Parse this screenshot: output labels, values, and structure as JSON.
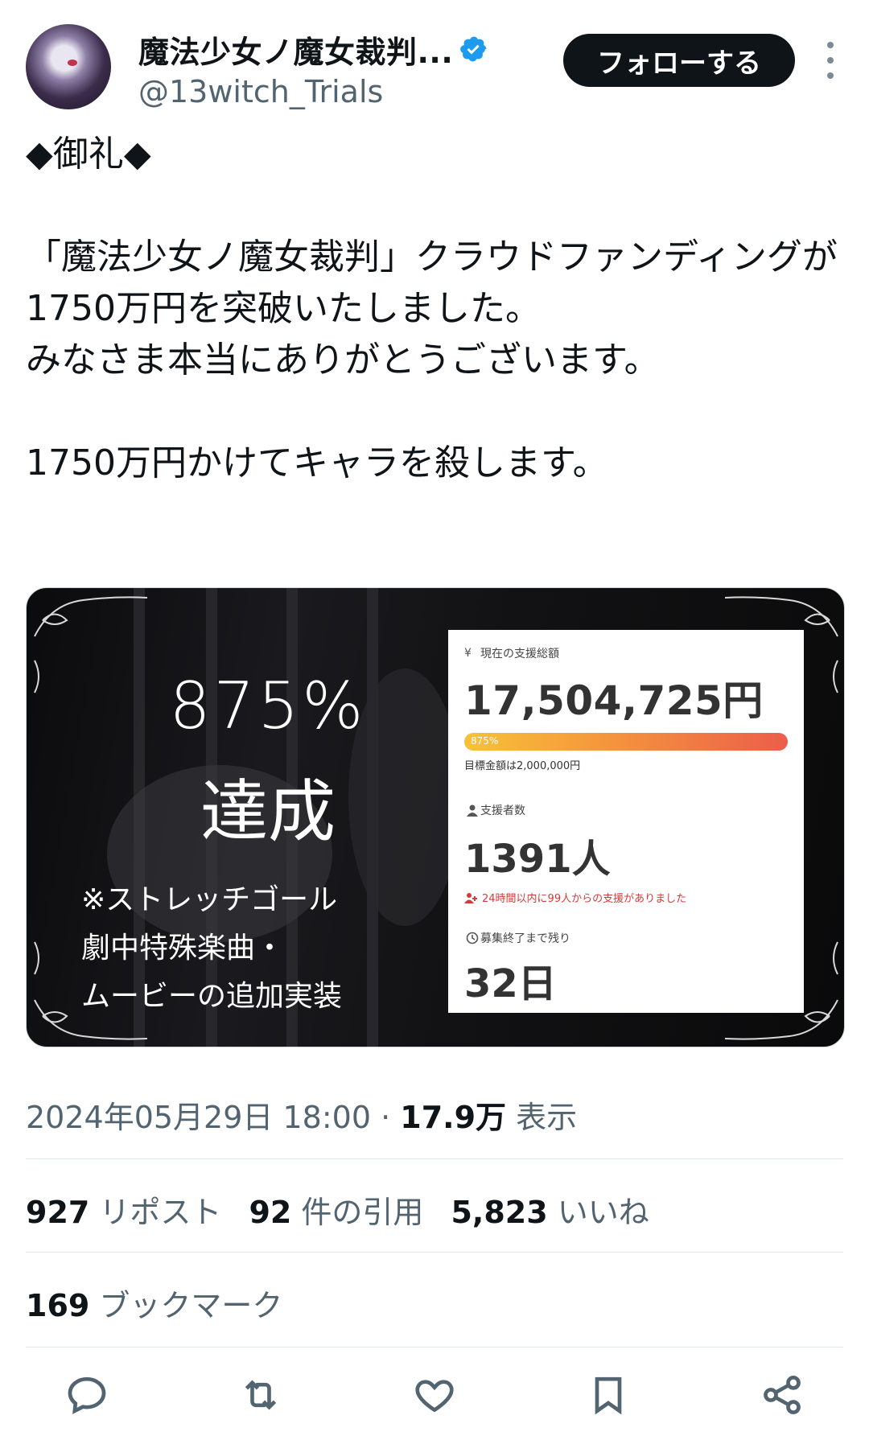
{
  "author": {
    "display_name": "魔法少女ノ魔女裁判...",
    "handle": "@13witch_Trials",
    "follow_label": "フォローする"
  },
  "tweet": {
    "text": "◆御礼◆\n\n「魔法少女ノ魔女裁判」クラウドファンディングが\n1750万円を突破いたしました。\nみなさま本当にありがとうございます。\n\n1750万円かけてキャラを殺します。"
  },
  "media": {
    "achievement_percent": "875%",
    "achievement_word": "達成",
    "stretch_goal": "※ストレッチゴール\n劇中特殊楽曲・\nムービーの追加実装",
    "panel": {
      "total_label": "現在の支援総額",
      "total_amount": "17,504,725円",
      "progress_label": "875%",
      "progress_percent": 875,
      "goal_text": "目標金額は2,000,000円",
      "backers_label": "支援者数",
      "backers_count": "1391人",
      "recent_text": "24時間以内に99人からの支援がありました",
      "remaining_label": "募集終了まで残り",
      "remaining_days": "32日"
    }
  },
  "meta": {
    "timestamp": "2024年05月29日 18:00",
    "separator": "·",
    "views_count": "17.9万",
    "views_label": "表示"
  },
  "stats": {
    "reposts_count": "927",
    "reposts_label": "リポスト",
    "quotes_count": "92",
    "quotes_label": "件の引用",
    "likes_count": "5,823",
    "likes_label": "いいね",
    "bookmarks_count": "169",
    "bookmarks_label": "ブックマーク"
  },
  "icons": [
    "verified-badge-icon",
    "more-icon",
    "reply-icon",
    "repost-icon",
    "like-icon",
    "bookmark-icon",
    "share-icon",
    "yen-icon",
    "person-icon",
    "clock-icon"
  ],
  "colors": {
    "verified": "#1d9bf0",
    "follow_bg": "#0f1419",
    "muted": "#536471",
    "bar_start": "#f7c237",
    "bar_end": "#ec5d4a",
    "recent_red": "#d43a3a"
  }
}
